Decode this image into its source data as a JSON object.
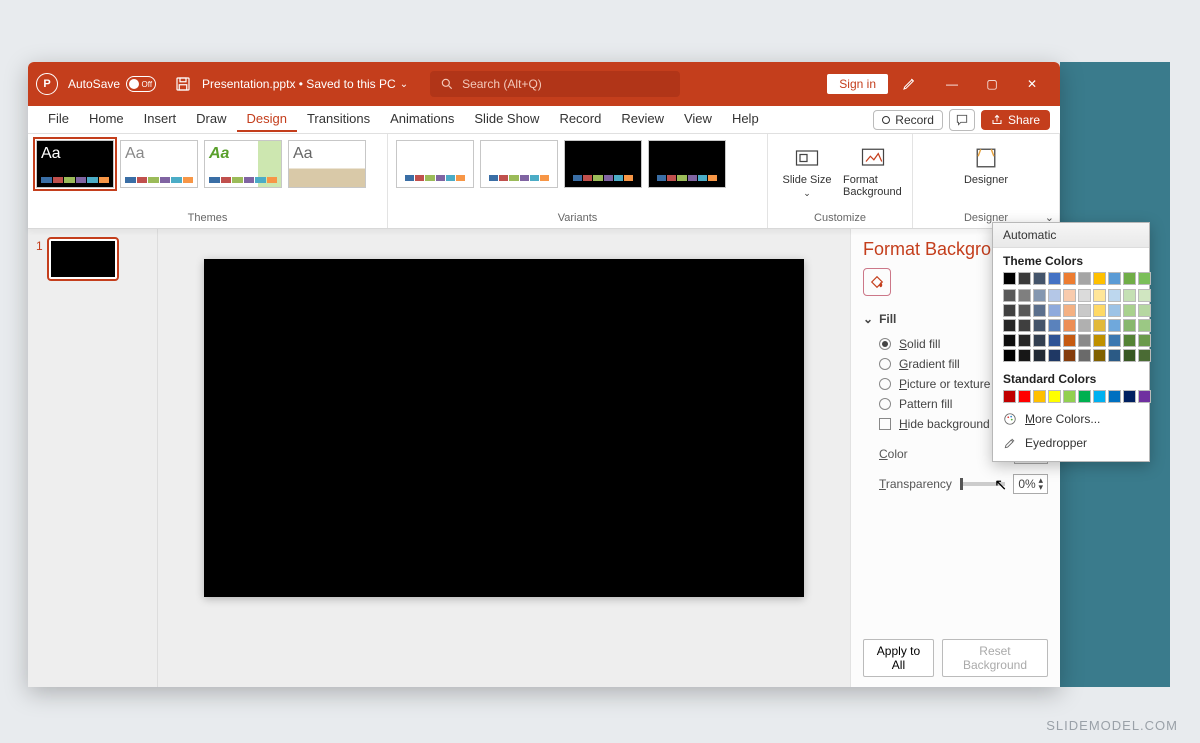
{
  "titlebar": {
    "autosave_label": "AutoSave",
    "autosave_state": "Off",
    "doc_title": "Presentation.pptx • Saved to this PC",
    "search_placeholder": "Search (Alt+Q)",
    "signin": "Sign in"
  },
  "menu": {
    "tabs": [
      "File",
      "Home",
      "Insert",
      "Draw",
      "Design",
      "Transitions",
      "Animations",
      "Slide Show",
      "Record",
      "Review",
      "View",
      "Help"
    ],
    "active": "Design",
    "record": "Record",
    "share": "Share"
  },
  "ribbon": {
    "themes_label": "Themes",
    "variants_label": "Variants",
    "customize_label": "Customize",
    "designer_label": "Designer",
    "slide_size": "Slide Size",
    "format_bg": "Format Background",
    "designer_btn": "Designer",
    "theme_text": "Aa"
  },
  "thumbs": {
    "slide1_num": "1"
  },
  "format_panel": {
    "title": "Format Background",
    "section_fill": "Fill",
    "opt_solid": "Solid fill",
    "opt_gradient": "Gradient fill",
    "opt_picture": "Picture or texture fill",
    "opt_pattern": "Pattern fill",
    "opt_hide": "Hide background graphics",
    "color_label": "Color",
    "transparency_label": "Transparency",
    "transparency_value": "0%",
    "apply_all": "Apply to All",
    "reset": "Reset Background"
  },
  "color_popup": {
    "automatic": "Automatic",
    "theme_colors": "Theme Colors",
    "standard_colors": "Standard Colors",
    "more_colors": "More Colors...",
    "eyedropper": "Eyedropper",
    "theme_row": [
      "#000000",
      "#3b3b3b",
      "#44546a",
      "#4472c4",
      "#ed7d31",
      "#a5a5a5",
      "#ffc000",
      "#5b9bd5",
      "#70ad47",
      "#7bbf5a"
    ],
    "theme_shades": [
      [
        "#595959",
        "#7f7f7f",
        "#8497b0",
        "#b4c7e7",
        "#f8cbad",
        "#dbdbdb",
        "#ffe699",
        "#bdd7ee",
        "#c5e0b4",
        "#d0e6c1"
      ],
      [
        "#404040",
        "#595959",
        "#5b6f8c",
        "#8faadc",
        "#f4b183",
        "#c9c9c9",
        "#ffd966",
        "#9dc3e6",
        "#a9d18e",
        "#b6d7a2"
      ],
      [
        "#262626",
        "#3f3f3f",
        "#44546a",
        "#5a82bc",
        "#ed8e55",
        "#b0b0b0",
        "#e2b93b",
        "#6fa8dc",
        "#88b76d",
        "#9bc884"
      ],
      [
        "#0d0d0d",
        "#262626",
        "#333f50",
        "#2e5395",
        "#c55a11",
        "#8a8a8a",
        "#bf9000",
        "#3c78b0",
        "#548235",
        "#6b9a4c"
      ],
      [
        "#000000",
        "#171717",
        "#222a35",
        "#1f3864",
        "#843c0c",
        "#6a6a6a",
        "#806000",
        "#2b5a85",
        "#385723",
        "#4a6b34"
      ]
    ],
    "standard_row": [
      "#c00000",
      "#ff0000",
      "#ffc000",
      "#ffff00",
      "#92d050",
      "#00b050",
      "#00b0f0",
      "#0070c0",
      "#002060",
      "#7030a0"
    ]
  },
  "watermark": "SLIDEMODEL.COM",
  "strip_colors": [
    "#3a6ea5",
    "#c0504d",
    "#9bbb59",
    "#8064a2",
    "#4bacc6",
    "#f79646"
  ]
}
